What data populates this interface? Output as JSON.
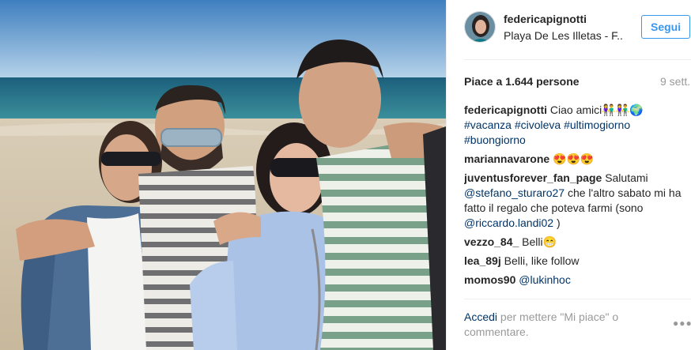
{
  "post": {
    "username": "federicapignotti",
    "location": "Playa De Les Illetas - F..",
    "follow_label": "Segui",
    "likes_label": "Piace a 1.644 persone",
    "time_label": "9 sett."
  },
  "caption": {
    "user": "federicapignotti",
    "text": "Ciao amici👫👫🌍",
    "hashtags": "#vacanza #civoleva #ultimogiorno #buongiorno"
  },
  "comments": [
    {
      "user": "mariannavarone",
      "text": "😍😍😍"
    },
    {
      "user": "juventusforever_fan_page",
      "text": "Salutami",
      "mention1": "@stefano_sturaro27",
      "text2": "che l'altro sabato mi ha fatto il regalo che poteva farmi (sono",
      "mention2": "@riccardo.landi02",
      "text3": ")"
    },
    {
      "user": "vezzo_84_",
      "text": "Belli😁"
    },
    {
      "user": "lea_89j",
      "text": "Belli, like follow"
    },
    {
      "user": "momos90",
      "text": "@lukinhoc"
    }
  ],
  "footer": {
    "login_link": "Accedi",
    "login_text": "per mettere \"Mi piace\" o commentare.",
    "more_icon": "more-options-icon"
  }
}
